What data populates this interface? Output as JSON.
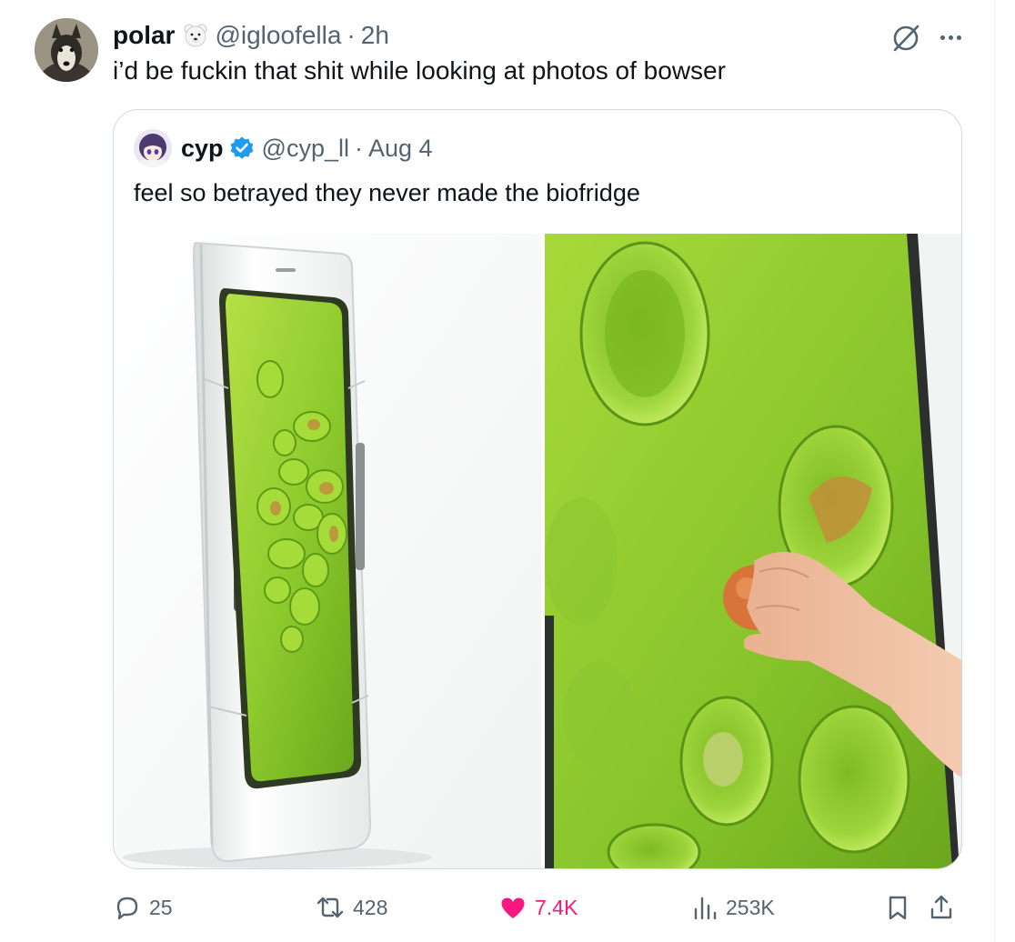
{
  "post": {
    "author_name": "polar",
    "handle": "@igloofella",
    "separator": "·",
    "time": "2h",
    "text": "i’d be fuckin that shit while looking at photos of bowser",
    "badge_icon": "polar-bear-emoji-icon"
  },
  "quoted_post": {
    "author_name": "cyp",
    "verified": true,
    "handle": "@cyp_ll",
    "separator": "·",
    "date": "Aug 4",
    "text": "feel so betrayed they never made the biofridge",
    "media": [
      "biofridge-product-photo",
      "biofridge-closeup-hand-photo"
    ]
  },
  "actions": {
    "replies": "25",
    "reposts": "428",
    "likes": "7.4K",
    "views": "253K"
  },
  "colors": {
    "muted": "#536471",
    "like": "#f91880",
    "verified": "#1d9bf0",
    "border": "#cfd9de",
    "gel_green": "#8fcc2e"
  }
}
